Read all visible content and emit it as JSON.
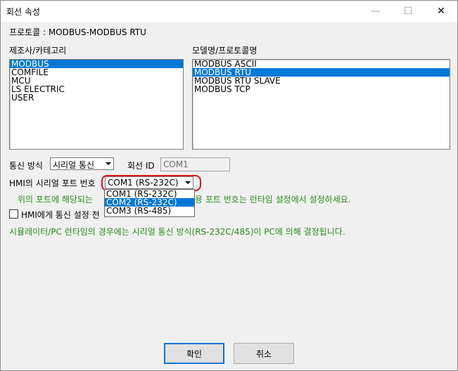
{
  "window": {
    "title": "회선 속성"
  },
  "protocol_line": "프로토콜 : MODBUS-MODBUS RTU",
  "manufacturer": {
    "label": "제조사/카테고리",
    "items": [
      "MODBUS",
      "COMFILE",
      "MCU",
      "LS ELECTRIC",
      "USER"
    ],
    "selected": "MODBUS"
  },
  "model": {
    "label": "모델명/프로토콜명",
    "items": [
      "MODBUS ASCII",
      "MODBUS RTU",
      "MODBUS RTU SLAVE",
      "MODBUS TCP"
    ],
    "selected": "MODBUS RTU"
  },
  "comm": {
    "method_label": "통신 방식",
    "method_value": "시리얼 통신",
    "line_id_label": "회선 ID",
    "line_id_value": "COM1"
  },
  "serial": {
    "port_label": "HMI의 시리얼 포트 번호",
    "port_value": "COM1 (RS-232C)",
    "options": [
      "COM1 (RS-232C)",
      "COM2 (RS-232C)",
      "COM3 (RS-485)"
    ],
    "highlighted_option": "COM2 (RS-232C)"
  },
  "note1_left": "위의 포트에 해당되는",
  "note1_right": "용 포트 번호는 런타임 설정에서 설정하세요.",
  "checkbox_label": "HMI에게 통신 설정 전",
  "note2": "시뮬레이터/PC 런타임의 경우에는 시리얼 통신 방식(RS-232C/485)이 PC에 의해 결정됩니다.",
  "buttons": {
    "ok": "확인",
    "cancel": "취소"
  },
  "colors": {
    "accent": "#0078d7",
    "note_green": "#2b8a1f",
    "highlight_red": "#e2141c"
  }
}
